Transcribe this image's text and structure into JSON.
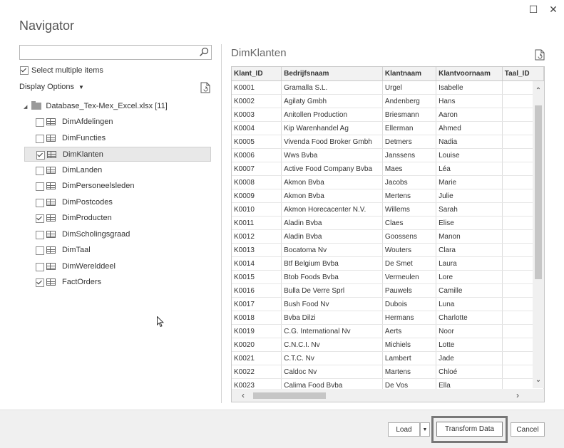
{
  "window": {
    "title": "Navigator",
    "maximize_glyph": "☐",
    "close_glyph": "✕"
  },
  "left_panel": {
    "search": {
      "value": "",
      "placeholder": ""
    },
    "select_multiple": {
      "label": "Select multiple items",
      "checked": true
    },
    "display_options": {
      "label": "Display Options",
      "caret": "▼"
    },
    "tree": {
      "root_label": "Database_Tex-Mex_Excel.xlsx [11]",
      "items": [
        {
          "label": "DimAfdelingen",
          "checked": false,
          "selected": false
        },
        {
          "label": "DimFuncties",
          "checked": false,
          "selected": false
        },
        {
          "label": "DimKlanten",
          "checked": true,
          "selected": true
        },
        {
          "label": "DimLanden",
          "checked": false,
          "selected": false
        },
        {
          "label": "DimPersoneelsleden",
          "checked": false,
          "selected": false
        },
        {
          "label": "DimPostcodes",
          "checked": false,
          "selected": false
        },
        {
          "label": "DimProducten",
          "checked": true,
          "selected": false
        },
        {
          "label": "DimScholingsgraad",
          "checked": false,
          "selected": false
        },
        {
          "label": "DimTaal",
          "checked": false,
          "selected": false
        },
        {
          "label": "DimWerelddeel",
          "checked": false,
          "selected": false
        },
        {
          "label": "FactOrders",
          "checked": true,
          "selected": false
        }
      ]
    }
  },
  "preview": {
    "title": "DimKlanten",
    "columns": [
      "Klant_ID",
      "Bedrijfsnaam",
      "Klantnaam",
      "Klantvoornaam",
      "Taal_ID"
    ],
    "rows": [
      [
        "K0001",
        "Gramalla S.L.",
        "Urgel",
        "Isabelle",
        ""
      ],
      [
        "K0002",
        "Agilaty Gmbh",
        "Andenberg",
        "Hans",
        ""
      ],
      [
        "K0003",
        "Anitollen Production",
        "Briesmann",
        "Aaron",
        ""
      ],
      [
        "K0004",
        "Kip Warenhandel Ag",
        "Ellerman",
        "Ahmed",
        ""
      ],
      [
        "K0005",
        "Vivenda Food Broker Gmbh",
        "Detmers",
        "Nadia",
        ""
      ],
      [
        "K0006",
        "Wws Bvba",
        "Janssens",
        "Louise",
        ""
      ],
      [
        "K0007",
        "Active Food Company Bvba",
        "Maes",
        "Léa",
        ""
      ],
      [
        "K0008",
        "Akmon Bvba",
        "Jacobs",
        "Marie",
        ""
      ],
      [
        "K0009",
        "Akmon Bvba",
        "Mertens",
        "Julie",
        ""
      ],
      [
        "K0010",
        "Akmon Horecacenter N.V.",
        "Willems",
        "Sarah",
        ""
      ],
      [
        "K0011",
        "Aladin Bvba",
        "Claes",
        "Elise",
        ""
      ],
      [
        "K0012",
        "Aladin Bvba",
        "Goossens",
        "Manon",
        ""
      ],
      [
        "K0013",
        "Bocatoma Nv",
        "Wouters",
        "Clara",
        ""
      ],
      [
        "K0014",
        "Btf Belgium Bvba",
        "De Smet",
        "Laura",
        ""
      ],
      [
        "K0015",
        "Btob Foods Bvba",
        "Vermeulen",
        "Lore",
        ""
      ],
      [
        "K0016",
        "Bulla De Verre Sprl",
        "Pauwels",
        "Camille",
        ""
      ],
      [
        "K0017",
        "Bush Food Nv",
        "Dubois",
        "Luna",
        ""
      ],
      [
        "K0018",
        "Bvba Dilzi",
        "Hermans",
        "Charlotte",
        ""
      ],
      [
        "K0019",
        "C.G. International Nv",
        "Aerts",
        "Noor",
        ""
      ],
      [
        "K0020",
        "C.N.C.I. Nv",
        "Michiels",
        "Lotte",
        ""
      ],
      [
        "K0021",
        "C.T.C. Nv",
        "Lambert",
        "Jade",
        ""
      ],
      [
        "K0022",
        "Caldoc Nv",
        "Martens",
        "Chloé",
        ""
      ],
      [
        "K0023",
        "Calima Food Bvba",
        "De Vos",
        "Ella",
        ""
      ]
    ]
  },
  "footer": {
    "load_label": "Load",
    "load_caret": "▼",
    "transform_label": "Transform Data",
    "cancel_label": "Cancel"
  }
}
